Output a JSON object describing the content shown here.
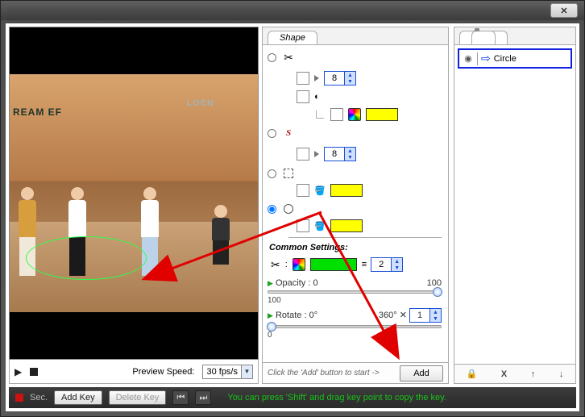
{
  "titlebar": {
    "close_label": "✕"
  },
  "preview": {
    "wall_text_left": "REAM  EF",
    "wall_text_right": "LOEN",
    "transport": {
      "speed_label": "Preview Speed:",
      "speed_value": "30 fps/s"
    }
  },
  "shape_panel": {
    "tab_label": "Shape",
    "tools": {
      "scissors": {
        "width": "8"
      },
      "curve": {
        "width": "8"
      }
    },
    "common": {
      "heading": "Common Settings:",
      "line_width": "2",
      "opacity_label": "Opacity",
      "opacity_min": "0",
      "opacity_max": "100",
      "opacity_value": "100",
      "rotate_label": "Rotate",
      "rotate_min": "0°",
      "rotate_max": "360°",
      "rotate_mult": "1",
      "rotate_value": "0"
    },
    "footer_hint": "Click the 'Add' button to start ->",
    "add_label": "Add"
  },
  "layers": {
    "item_label": "Circle"
  },
  "timeline": {
    "green_dot_label": "",
    "sec_label": "Sec.",
    "add_key": "Add Key",
    "delete_key": "Delete Key",
    "tip": "You can press 'Shift' and drag key point to copy the key."
  }
}
